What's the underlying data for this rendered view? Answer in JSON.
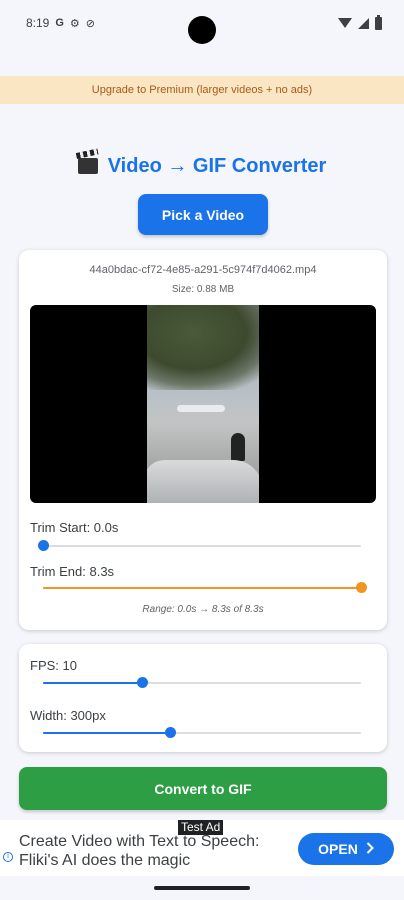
{
  "status_bar": {
    "time": "8:19",
    "icons": [
      "google-icon",
      "settings-icon",
      "blocked-icon",
      "wifi-icon",
      "signal-icon",
      "battery-icon"
    ],
    "icon_glyphs": {
      "google": "G",
      "settings": "⚙",
      "blocked": "⊘"
    }
  },
  "premium_banner": {
    "text": "Upgrade to Premium (larger videos + no ads)"
  },
  "header": {
    "title": "Video → GIF Converter"
  },
  "pick_button": {
    "label": "Pick a Video"
  },
  "video_card": {
    "file_name": "44a0bdac-cf72-4e85-a291-5c974f7d4062.mp4",
    "size_text": "Size: 0.88 MB",
    "trim_start": {
      "label": "Trim Start: 0.0s",
      "value": 0.0,
      "max": 8.3
    },
    "trim_end": {
      "label": "Trim End: 8.3s",
      "value": 8.3,
      "max": 8.3
    },
    "range_text": "Range: 0.0s → 8.3s of 8.3s"
  },
  "settings_card": {
    "fps": {
      "label": "FPS: 10",
      "fraction": 0.31
    },
    "width": {
      "label": "Width: 300px",
      "fraction": 0.4
    }
  },
  "convert_button": {
    "label": "Convert to GIF"
  },
  "ad": {
    "badge": "Test Ad",
    "text": "Create Video with Text to Speech: Fliki's AI does the magic",
    "button_label": "OPEN",
    "button_icon": "chevron-right-icon"
  },
  "colors": {
    "primary": "#1a73e8",
    "convert": "#2e9e44",
    "trim_end_accent": "#f29422",
    "banner_bg": "#fbe6c4"
  }
}
